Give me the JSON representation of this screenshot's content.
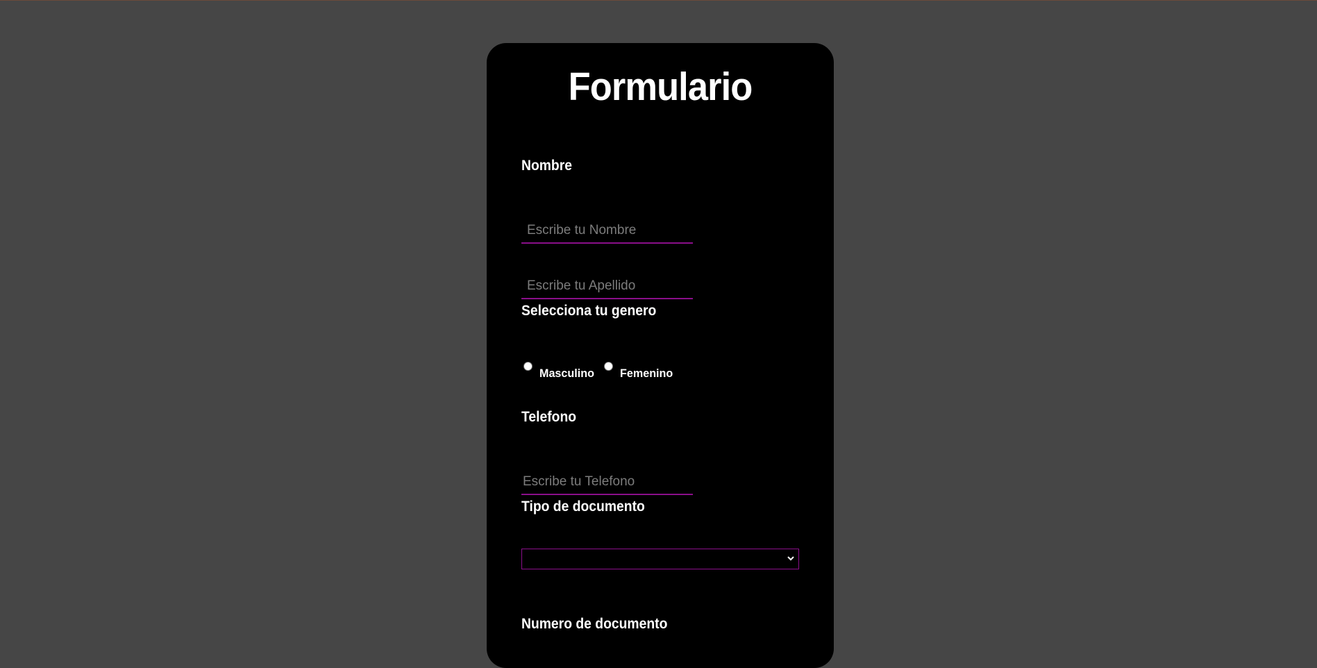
{
  "form": {
    "title": "Formulario",
    "nombre_label": "Nombre",
    "nombre_placeholder": "Escribe tu Nombre",
    "apellido_placeholder": "Escribe tu Apellido",
    "genero_label": "Selecciona tu genero",
    "genero_options": [
      "Masculino",
      "Femenino"
    ],
    "telefono_label": "Telefono",
    "telefono_placeholder": "Escribe tu Telefono",
    "documento_tipo_label": "Tipo de documento",
    "documento_tipo_value": "",
    "documento_numero_label": "Numero de documento"
  },
  "colors": {
    "page_background": "#464646",
    "card_background": "#000000",
    "accent": "#8a0f8a",
    "text": "#ffffff",
    "placeholder": "#7c7c7c"
  },
  "icons": {
    "select_arrow": "chevron-down-icon"
  }
}
